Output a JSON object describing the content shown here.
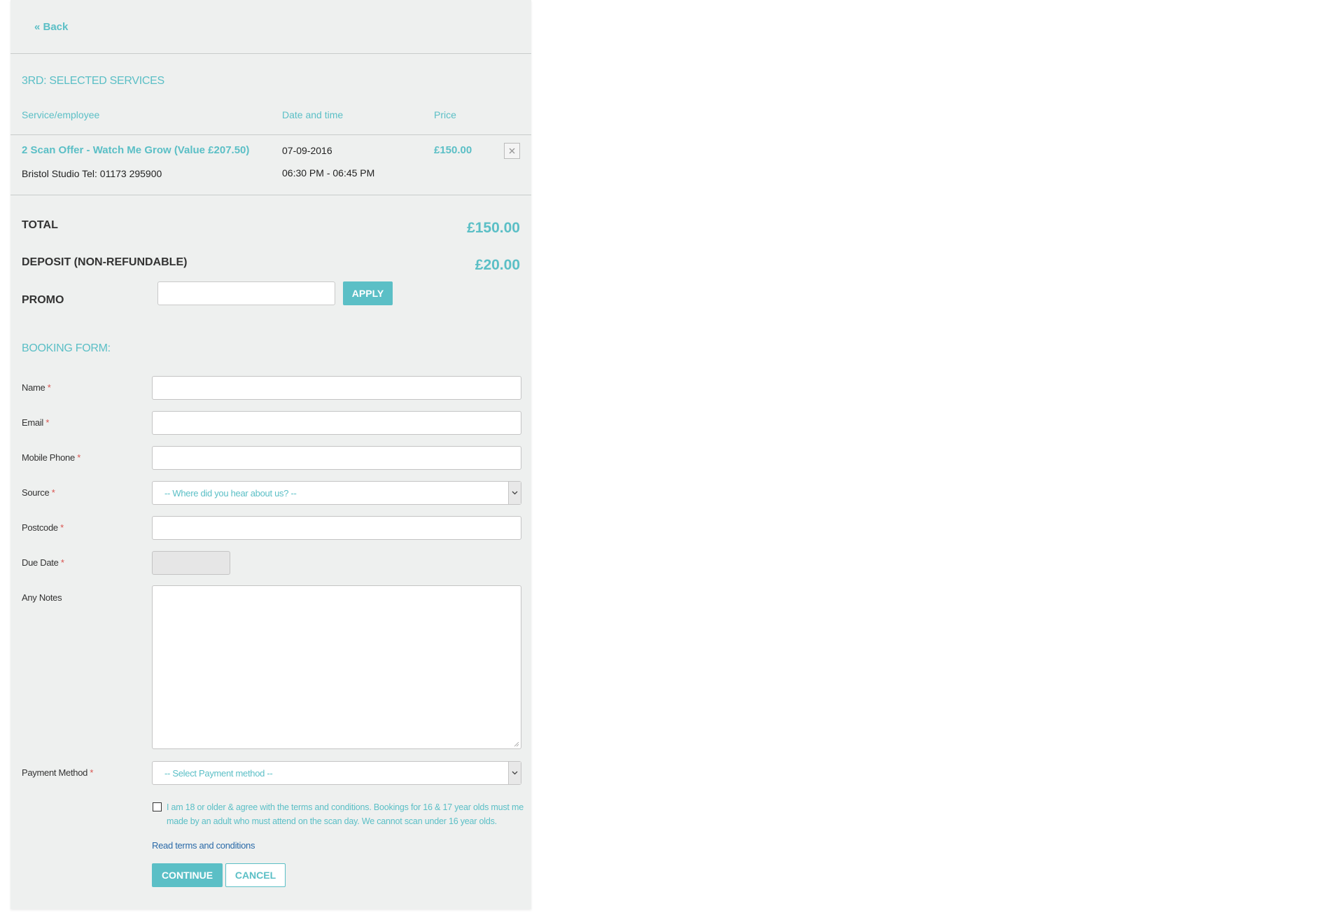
{
  "nav": {
    "back_label": "« Back"
  },
  "services": {
    "title": "3RD: SELECTED SERVICES",
    "columns": {
      "service": "Service/employee",
      "date": "Date and time",
      "price": "Price"
    },
    "item": {
      "name": "2 Scan Offer - Watch Me Grow (Value £207.50)",
      "location": "Bristol Studio Tel: 01173 295900",
      "date": "07-09-2016",
      "time": "06:30 PM - 06:45 PM",
      "price": "£150.00",
      "remove_icon": "close-icon"
    }
  },
  "summary": {
    "total_label": "TOTAL",
    "total_value": "£150.00",
    "deposit_label": "DEPOSIT (NON-REFUNDABLE)",
    "deposit_value": "£20.00",
    "promo_label": "PROMO",
    "promo_value": "",
    "apply_label": "APPLY"
  },
  "form": {
    "title": "BOOKING FORM:",
    "required_marker": "*",
    "name_label": "Name",
    "email_label": "Email",
    "phone_label": "Mobile Phone",
    "source_label": "Source",
    "source_selected": "-- Where did you hear about us? --",
    "postcode_label": "Postcode",
    "due_date_label": "Due Date",
    "notes_label": "Any Notes",
    "payment_label": "Payment Method",
    "payment_selected": "-- Select Payment method --",
    "agree_text": "I am 18 or older & agree with the terms and conditions. Bookings for 16 & 17 year olds must me made by an adult who must attend on the scan day. We cannot scan under 16 year olds.",
    "terms_link": "Read terms and conditions",
    "continue_label": "CONTINUE",
    "cancel_label": "CANCEL"
  },
  "colors": {
    "accent": "#5bbfc6",
    "panel_bg": "#eef0ef",
    "required": "#d9534f",
    "link": "#2a6aa8"
  }
}
